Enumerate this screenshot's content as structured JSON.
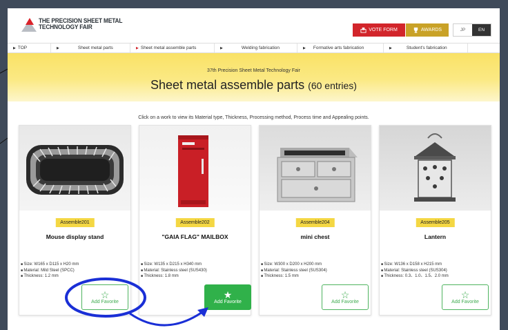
{
  "header": {
    "logo_line1": "THE PRECISION SHEET METAL",
    "logo_line2": "TECHNOLOGY FAIR",
    "vote_label": "VOTE FORM",
    "awards_label": "AWARDS",
    "lang_jp": "JP",
    "lang_en": "EN"
  },
  "nav": [
    {
      "label": "TOP"
    },
    {
      "label": "Sheet metal parts"
    },
    {
      "label": "Sheet metal assemble parts"
    },
    {
      "label": "Welding fabrication"
    },
    {
      "label": "Formative arts fabrication"
    },
    {
      "label": "Student's fabrication"
    }
  ],
  "banner": {
    "fair": "37th Precision Sheet Metal Technology Fair",
    "title": "Sheet metal assemble parts",
    "count": "(60 entries)"
  },
  "instruction": "Click on a work to view its Material type, Thickness, Processing method, Process time and Appealing points.",
  "cards": [
    {
      "tag": "Assemble201",
      "name": "Mouse display stand",
      "specs": [
        "Size: W165 x D115 x H20 mm",
        "Material: Mild Steel (SPCC)",
        "Thickness: 1.2 mm"
      ],
      "fav_label": "Add Favorite",
      "favorited": false
    },
    {
      "tag": "Assemble202",
      "name": "\"GAIA FLAG\" MAILBOX",
      "specs": [
        "Size: W135 x D215 x H340 mm",
        "Material: Stainless steel (SUS430)",
        "Thickness: 1.8 mm"
      ],
      "fav_label": "Add Favorite",
      "favorited": true
    },
    {
      "tag": "Assemble204",
      "name": "mini chest",
      "specs": [
        "Size: W300 x D200 x H200 mm",
        "Material: Stainless steel (SUS304)",
        "Thickness: 1.5 mm"
      ],
      "fav_label": "Add Favorite",
      "favorited": false
    },
    {
      "tag": "Assemble205",
      "name": "Lantern",
      "specs": [
        "Size: W136 x D158 x H215 mm",
        "Material: Stainless steel (SUS304)",
        "Thickness: 0.3、1.0、1.5、2.0 mm"
      ],
      "fav_label": "Add Favorite",
      "favorited": false
    }
  ],
  "colors": {
    "accent_red": "#d2252b",
    "awards_gold": "#c9a227",
    "banner_yellow": "#f9e266",
    "tag_yellow": "#f4d743",
    "favorite_green": "#30b14a",
    "annotation_blue": "#1a2fd6"
  },
  "icons": {
    "vote": "ballot-box-icon",
    "awards": "trophy-icon",
    "favorite_empty": "star-outline-icon",
    "favorite_filled": "star-filled-icon"
  }
}
